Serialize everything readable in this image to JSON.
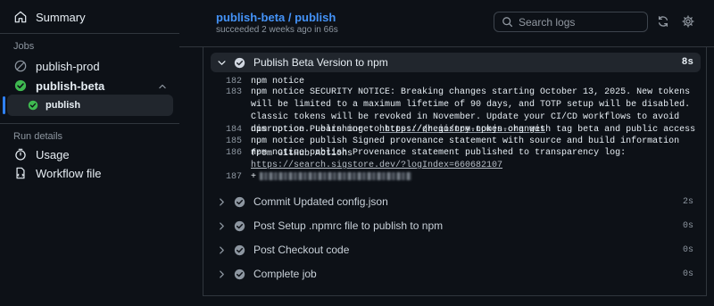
{
  "sidebar": {
    "summary_label": "Summary",
    "jobs_section": "Jobs",
    "jobs": [
      {
        "label": "publish-prod",
        "status": "skipped"
      },
      {
        "label": "publish-beta",
        "status": "success",
        "expanded": true,
        "children": [
          {
            "label": "publish",
            "status": "success",
            "selected": true
          }
        ]
      }
    ],
    "run_details_section": "Run details",
    "usage_label": "Usage",
    "workflow_file_label": "Workflow file"
  },
  "header": {
    "title": "publish-beta / publish",
    "subtitle": "succeeded 2 weeks ago in 66s",
    "search_placeholder": "Search logs"
  },
  "expanded_step": {
    "title": "Publish Beta Version to npm",
    "duration": "8s",
    "lines": [
      {
        "num": "182",
        "text": "npm notice"
      },
      {
        "num": "183",
        "text_a": "npm notice SECURITY NOTICE: Breaking changes starting October 13, 2025. New tokens will be limited to a maximum lifetime of 90 days, and TOTP setup will be disabled. Classic tokens will be revoked in November. Update your CI/CD workflows to avoid disruption. Learn more: ",
        "link": "https://gh.io/npm-token-changes"
      },
      {
        "num": "184",
        "text_a": "npm notice Publishing to ",
        "link": "https://registry.npmjs.org",
        "text_b": " with tag beta and public access"
      },
      {
        "num": "185",
        "text": "npm notice publish Signed provenance statement with source and build information from GitHub Actions"
      },
      {
        "num": "186",
        "text_a": "npm notice publish Provenance statement published to transparency log: ",
        "link": "https://search.sigstore.dev/?logIndex=660682107"
      },
      {
        "num": "187",
        "text": "+"
      }
    ]
  },
  "steps": [
    {
      "title": "Commit Updated config.json",
      "duration": "2s"
    },
    {
      "title": "Post Setup .npmrc file to publish to npm",
      "duration": "0s"
    },
    {
      "title": "Post Checkout code",
      "duration": "0s"
    },
    {
      "title": "Complete job",
      "duration": "0s"
    }
  ],
  "colors": {
    "success": "#3fb950",
    "accent": "#2f81f7",
    "muted": "#8d96a0",
    "step_check": "#8d96a0"
  }
}
